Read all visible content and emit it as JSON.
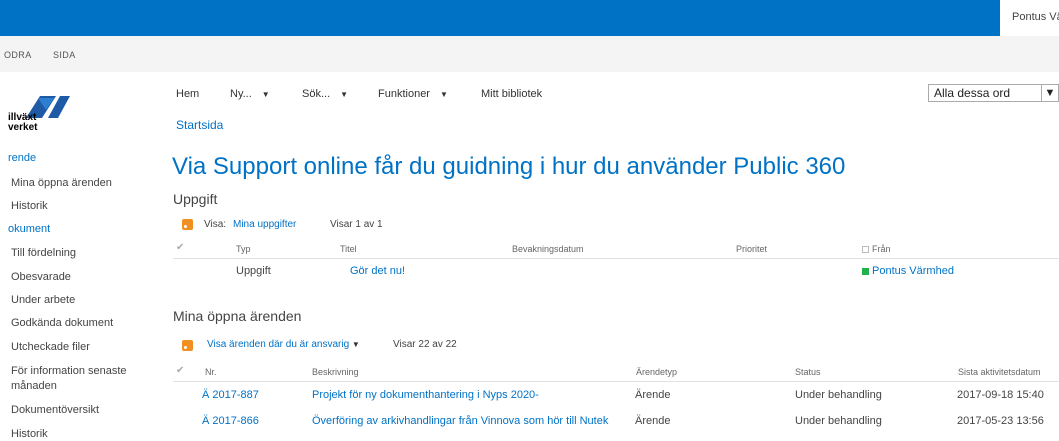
{
  "header": {
    "user": "Pontus Vä"
  },
  "ribbon": {
    "tabs": [
      "ODRA",
      "SIDA"
    ]
  },
  "logo": {
    "text_line1": "illväxt",
    "text_line2": "verket"
  },
  "sidebar": {
    "section1": "rende",
    "items1": [
      "Mina öppna ärenden",
      "Historik"
    ],
    "section2": "okument",
    "items2": [
      "Till fördelning",
      "Obesvarade",
      "Under arbete",
      "Godkända dokument",
      "Utcheckade filer",
      "För information senaste",
      "månaden",
      "Dokumentöversikt",
      "Historik"
    ]
  },
  "topnav": {
    "home": "Hem",
    "new": "Ny...",
    "search": "Sök...",
    "functions": "Funktioner",
    "library": "Mitt bibliotek",
    "search_mode": "Alla dessa ord"
  },
  "breadcrumb": "Startsida",
  "title": "Via Support online får du guidning i hur du använder Public 360",
  "tasks": {
    "heading": "Uppgift",
    "view_label": "Visa:",
    "view_value": "Mina uppgifter",
    "count": "Visar 1 av 1",
    "columns": [
      "Typ",
      "Titel",
      "Bevakningsdatum",
      "Prioritet",
      "Från"
    ],
    "rows": [
      {
        "typ": "Uppgift",
        "titel": "Gör det nu!",
        "fran": "Pontus Värmhed"
      }
    ]
  },
  "cases": {
    "heading": "Mina öppna ärenden",
    "view_value": "Visa ärenden där du är ansvarig",
    "count": "Visar 22 av 22",
    "columns": [
      "Nr.",
      "Beskrivning",
      "Ärendetyp",
      "Status",
      "Sista aktivitetsdatum"
    ],
    "rows": [
      {
        "nr": "Ä 2017-887",
        "desc": "Projekt för ny dokumenthantering i Nyps 2020-",
        "typ": "Ärende",
        "status": "Under behandling",
        "date": "2017-09-18 15:40"
      },
      {
        "nr": "Ä 2017-866",
        "desc": "Överföring av arkivhandlingar från Vinnova som hör till Nutek",
        "typ": "Ärende",
        "status": "Under behandling",
        "date": "2017-05-23 13:56"
      }
    ]
  },
  "colors": {
    "accent": "#0072c6",
    "topbar": "#0072c6",
    "rss": "#f09022",
    "status_green": "#21b14b"
  }
}
